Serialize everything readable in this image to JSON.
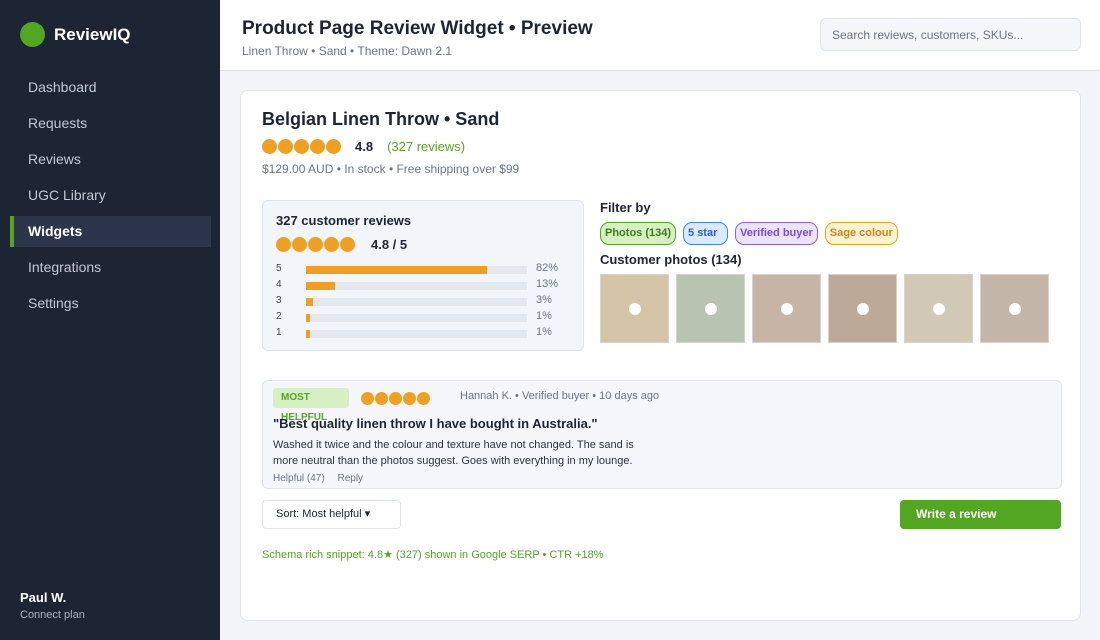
{
  "app": {
    "name": "ReviewIQ"
  },
  "sidebar": {
    "items": [
      {
        "label": "Dashboard"
      },
      {
        "label": "Requests"
      },
      {
        "label": "Reviews"
      },
      {
        "label": "UGC Library"
      },
      {
        "label": "Widgets",
        "active": true
      },
      {
        "label": "Integrations"
      },
      {
        "label": "Settings"
      }
    ],
    "user": {
      "name": "Paul W.",
      "plan": "Connect plan"
    }
  },
  "header": {
    "title": "Product Page Review Widget  •  Preview",
    "subtitle": "Linen Throw  •  Sand  •  Theme: Dawn 2.1",
    "search_placeholder": "Search reviews, customers, SKUs..."
  },
  "product": {
    "title": "Belgian Linen Throw  •  Sand",
    "rating_value": "4.8",
    "rating_stars": 5,
    "review_count_label": "(327 reviews)",
    "meta": "$129.00 AUD  •  In stock  •  Free shipping over $99"
  },
  "summary": {
    "title": "327 customer reviews",
    "rating_label": "4.8 / 5",
    "histogram": [
      {
        "label": "5",
        "percent": 82,
        "percent_label": "82%"
      },
      {
        "label": "4",
        "percent": 13,
        "percent_label": "13%"
      },
      {
        "label": "3",
        "percent": 3,
        "percent_label": "3%"
      },
      {
        "label": "2",
        "percent": 1,
        "percent_label": "1%"
      },
      {
        "label": "1",
        "percent": 1,
        "percent_label": "1%"
      }
    ]
  },
  "filters": {
    "label": "Filter by",
    "chips": [
      {
        "label": "Photos (134)"
      },
      {
        "label": "5 star"
      },
      {
        "label": "Verified buyer"
      },
      {
        "label": "Sage colour"
      }
    ]
  },
  "photos": {
    "label": "Customer photos (134)",
    "tile_colors": [
      "#d4c4a8",
      "#b6c4b0",
      "#c6b4a6",
      "#bca998",
      "#d2c8b6",
      "#c4b6a8"
    ]
  },
  "featured_review": {
    "badge": "MOST HELPFUL",
    "stars": 5,
    "meta": "Hannah K.  •  Verified buyer  •  10 days ago",
    "title": "\"Best quality linen throw I have bought in Australia.\"",
    "body": "Washed it twice and the colour and texture have not changed. The sand is more neutral than the photos suggest. Goes with everything in my lounge.",
    "helpful_label": "Helpful (47)",
    "reply_label": "Reply"
  },
  "controls": {
    "sort_label": "Sort: Most helpful ▾",
    "write_review_label": "Write a review"
  },
  "footer_note": "Schema rich snippet: 4.8★ (327) shown in Google SERP  •  CTR +18%",
  "colors": {
    "accent": "#52a620",
    "star": "#f0a020",
    "sidebar": "#1d2433"
  }
}
